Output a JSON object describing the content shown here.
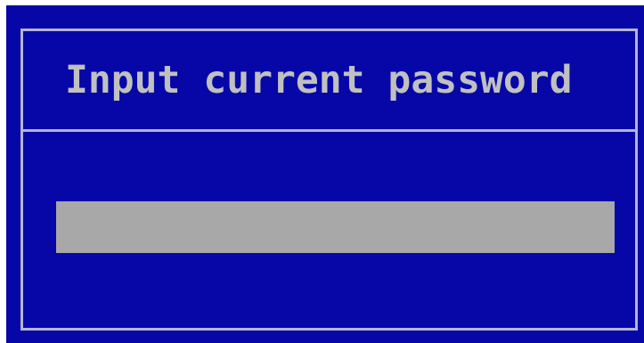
{
  "dialog": {
    "title": "Input current password",
    "password_field": {
      "value": "",
      "placeholder": ""
    }
  },
  "colors": {
    "background": "#0707a8",
    "border": "#b4b4d4",
    "text": "#c0c0c0",
    "input": "#a8a8a8"
  }
}
